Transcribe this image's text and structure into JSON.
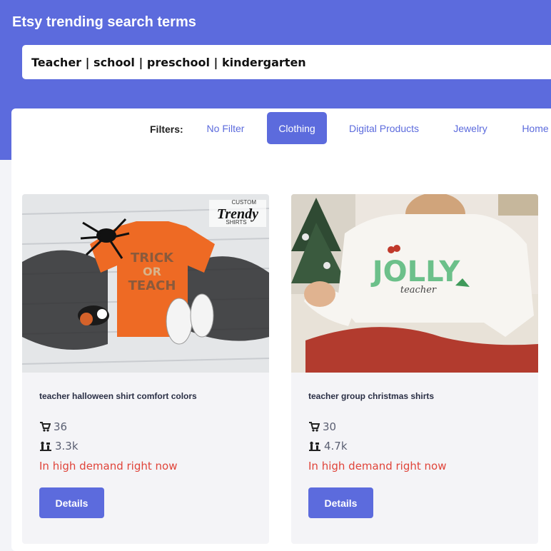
{
  "app": {
    "title": "Etsy trending search terms"
  },
  "search": {
    "value": "Teacher | school | preschool | kindergarten"
  },
  "filters": {
    "label": "Filters:",
    "options": [
      "No Filter",
      "Clothing",
      "Digital Products",
      "Jewelry",
      "Home"
    ],
    "active": "Clothing"
  },
  "cards": [
    {
      "title": "teacher halloween shirt comfort colors",
      "sales": "36",
      "competitors": "3.3k",
      "demand": "In high demand right now",
      "details_label": "Details",
      "image_text": {
        "logo_top": "CUSTOM",
        "logo_main": "Trendy",
        "logo_bottom": "SHIRTS",
        "shirt_line1": "TRICK",
        "shirt_line2": "OR",
        "shirt_line3": "TEACH"
      }
    },
    {
      "title": "teacher group christmas shirts",
      "sales": "30",
      "competitors": "4.7k",
      "demand": "In high demand right now",
      "details_label": "Details",
      "image_text": {
        "shirt_main": "JOLLY",
        "shirt_sub": "teacher"
      }
    }
  ],
  "icons": {
    "sales": "cart-icon",
    "competitors": "chess-pieces-icon"
  },
  "colors": {
    "accent": "#5c6bdd",
    "demand": "#e0443a",
    "white": "#ffffff"
  }
}
